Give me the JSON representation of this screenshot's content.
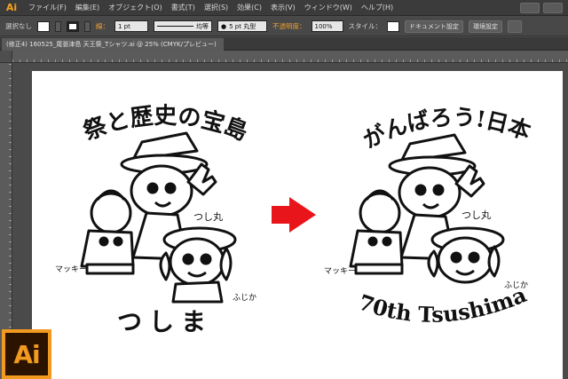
{
  "app": {
    "logo": "Ai"
  },
  "menu": [
    "ファイル(F)",
    "編集(E)",
    "オブジェクト(O)",
    "書式(T)",
    "選択(S)",
    "効果(C)",
    "表示(V)",
    "ウィンドウ(W)",
    "ヘルプ(H)"
  ],
  "control": {
    "selection_label": "選択なし",
    "stroke_label": "線：",
    "stroke_weight": "1 pt",
    "profile": "均等",
    "brush": "5 pt 丸型",
    "opacity_label": "不透明度：",
    "opacity_value": "100%",
    "style_label": "スタイル：",
    "doc_settings": "ドキュメント設定",
    "preferences": "環境設定"
  },
  "document": {
    "tab_title": "(修正4) 160525_尾張津島 天王祭_Tシャツ.ai @ 25% (CMYK/プレビュー)"
  },
  "artwork": {
    "left_title": "祭と歴史の宝島",
    "left_bottom": "つしま",
    "right_title": "がんばろう!日本",
    "right_bottom": "70th Tsushima",
    "label_tsushimaru": "つし丸",
    "label_makki": "マッキー",
    "label_fujika": "ふじか"
  },
  "badge": {
    "text": "Ai"
  },
  "colors": {
    "arrow": "#e8161b",
    "ai_orange": "#f29a1f",
    "ai_dark": "#2b1300"
  }
}
